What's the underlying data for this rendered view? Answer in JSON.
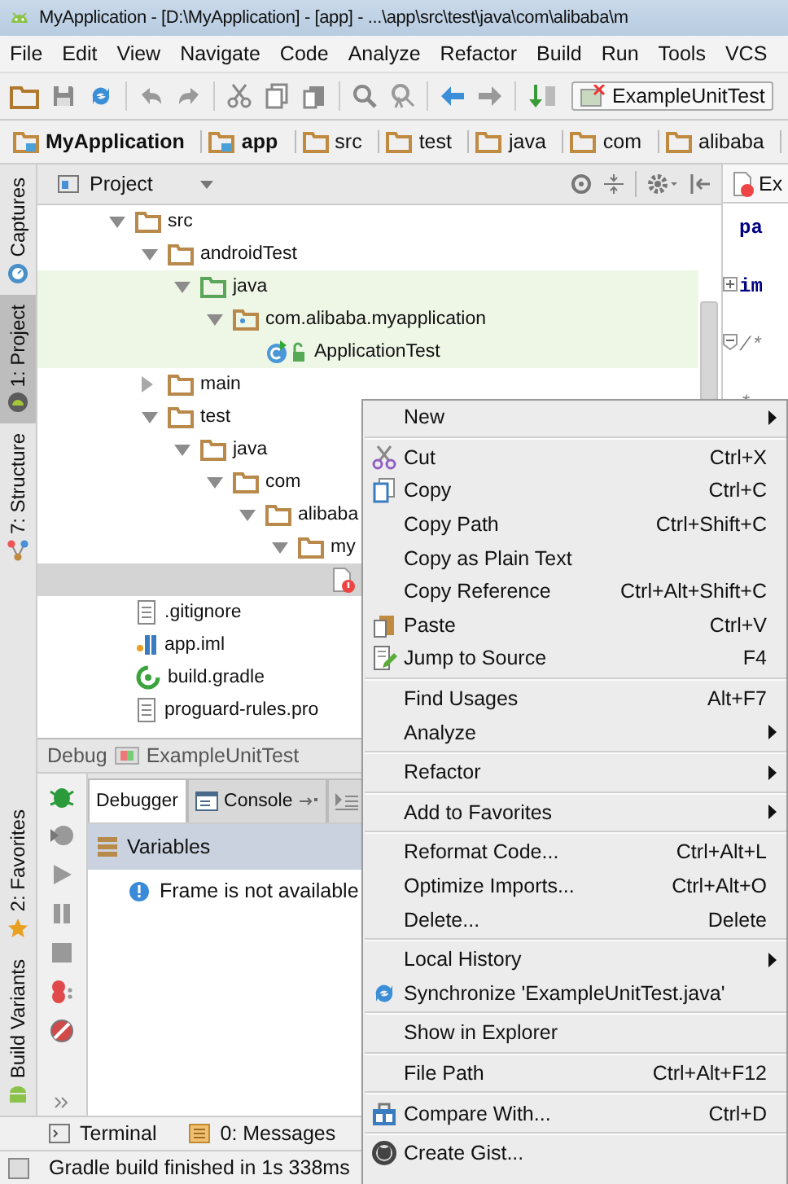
{
  "window": {
    "title": "MyApplication - [D:\\MyApplication] - [app] - ...\\app\\src\\test\\java\\com\\alibaba\\m"
  },
  "menu_bar": [
    "File",
    "Edit",
    "View",
    "Navigate",
    "Code",
    "Analyze",
    "Refactor",
    "Build",
    "Run",
    "Tools",
    "VCS"
  ],
  "toolbar": {
    "run_config": "ExampleUnitTest"
  },
  "breadcrumb": [
    {
      "label": "MyApplication",
      "kind": "module"
    },
    {
      "label": "app",
      "kind": "module"
    },
    {
      "label": "src",
      "kind": "folder"
    },
    {
      "label": "test",
      "kind": "folder"
    },
    {
      "label": "java",
      "kind": "folder"
    },
    {
      "label": "com",
      "kind": "folder"
    },
    {
      "label": "alibaba",
      "kind": "folder"
    }
  ],
  "left_tool_tabs": [
    {
      "label": "Captures",
      "selected": false
    },
    {
      "label": "1: Project",
      "selected": true
    },
    {
      "label": "7: Structure",
      "selected": false
    }
  ],
  "left_tool_tabs_bottom": [
    {
      "label": "2: Favorites",
      "selected": false
    },
    {
      "label": "Build Variants",
      "selected": false
    }
  ],
  "project_panel": {
    "view": "Project",
    "tree": [
      {
        "name": "src",
        "kind": "folder",
        "expanded": true,
        "selected": false,
        "highlighted": false,
        "children": [
          {
            "name": "androidTest",
            "kind": "folder",
            "expanded": true,
            "selected": false,
            "highlighted": false,
            "children": [
              {
                "name": "java",
                "kind": "source-folder",
                "expanded": true,
                "selected": false,
                "highlighted": true,
                "children": [
                  {
                    "name": "com.alibaba.myapplication",
                    "kind": "package",
                    "expanded": true,
                    "selected": false,
                    "highlighted": true,
                    "children": [
                      {
                        "name": "ApplicationTest",
                        "kind": "test-class",
                        "selected": false,
                        "highlighted": true
                      }
                    ]
                  }
                ]
              }
            ]
          },
          {
            "name": "main",
            "kind": "folder",
            "expanded": false,
            "selected": false,
            "highlighted": false
          },
          {
            "name": "test",
            "kind": "folder",
            "expanded": true,
            "selected": false,
            "highlighted": false,
            "children": [
              {
                "name": "java",
                "kind": "folder",
                "expanded": true,
                "selected": false,
                "highlighted": false,
                "children": [
                  {
                    "name": "com",
                    "kind": "folder",
                    "expanded": true,
                    "selected": false,
                    "highlighted": false,
                    "children": [
                      {
                        "name": "alibaba",
                        "kind": "folder",
                        "expanded": true,
                        "selected": false,
                        "highlighted": false,
                        "children": [
                          {
                            "name": "my",
                            "kind": "folder",
                            "expanded": true,
                            "selected": false,
                            "highlighted": false,
                            "children": [
                              {
                                "kind": "error-file",
                                "selected": true,
                                "highlighted": false
                              }
                            ]
                          }
                        ]
                      }
                    ]
                  }
                ]
              }
            ]
          }
        ]
      },
      {
        "name": ".gitignore",
        "kind": "text-file",
        "selected": false,
        "highlighted": false
      },
      {
        "name": "app.iml",
        "kind": "module-file",
        "selected": false,
        "highlighted": false
      },
      {
        "name": "build.gradle",
        "kind": "gradle-file",
        "selected": false,
        "highlighted": false
      },
      {
        "name": "proguard-rules.pro",
        "kind": "text-file",
        "selected": false,
        "highlighted": false
      }
    ]
  },
  "editor": {
    "tab": "Ex",
    "lines": [
      {
        "text": "pa",
        "kind": "keyword"
      },
      {
        "text": "im",
        "kind": "keyword-fold"
      },
      {
        "text": "/*",
        "kind": "comment-fold"
      },
      {
        "text": "*",
        "kind": "comment"
      }
    ]
  },
  "debug_panel": {
    "title": "Debug",
    "config": "ExampleUnitTest",
    "tabs": [
      {
        "label": "Debugger",
        "selected": true
      },
      {
        "label": "Console",
        "selected": false
      }
    ],
    "section": "Variables",
    "message": "Frame is not available"
  },
  "bottom_tabs": [
    "Terminal",
    "0: Messages"
  ],
  "status_bar": "Gradle build finished in 1s 338ms",
  "context_menu": [
    {
      "kind": "text",
      "label": "New",
      "submenu": true
    },
    {
      "kind": "separator"
    },
    {
      "kind": "cut",
      "label": "Cut",
      "shortcut": "Ctrl+X",
      "submenu": false
    },
    {
      "kind": "copy",
      "label": "Copy",
      "shortcut": "Ctrl+C",
      "submenu": false
    },
    {
      "kind": "text",
      "label": "Copy Path",
      "shortcut": "Ctrl+Shift+C",
      "submenu": false
    },
    {
      "kind": "text",
      "label": "Copy as Plain Text",
      "submenu": false
    },
    {
      "kind": "text",
      "label": "Copy Reference",
      "shortcut": "Ctrl+Alt+Shift+C",
      "submenu": false
    },
    {
      "kind": "paste",
      "label": "Paste",
      "shortcut": "Ctrl+V",
      "submenu": false
    },
    {
      "kind": "jump",
      "label": "Jump to Source",
      "shortcut": "F4",
      "submenu": false
    },
    {
      "kind": "separator"
    },
    {
      "kind": "text",
      "label": "Find Usages",
      "shortcut": "Alt+F7",
      "submenu": false
    },
    {
      "kind": "text",
      "label": "Analyze",
      "submenu": true
    },
    {
      "kind": "separator"
    },
    {
      "kind": "text",
      "label": "Refactor",
      "submenu": true
    },
    {
      "kind": "separator"
    },
    {
      "kind": "text",
      "label": "Add to Favorites",
      "submenu": true
    },
    {
      "kind": "separator"
    },
    {
      "kind": "text",
      "label": "Reformat Code...",
      "shortcut": "Ctrl+Alt+L",
      "submenu": false
    },
    {
      "kind": "text",
      "label": "Optimize Imports...",
      "shortcut": "Ctrl+Alt+O",
      "submenu": false
    },
    {
      "kind": "text",
      "label": "Delete...",
      "shortcut": "Delete",
      "submenu": false
    },
    {
      "kind": "separator"
    },
    {
      "kind": "text",
      "label": "Local History",
      "submenu": true
    },
    {
      "kind": "sync",
      "label": "Synchronize 'ExampleUnitTest.java'",
      "submenu": false
    },
    {
      "kind": "separator"
    },
    {
      "kind": "text",
      "label": "Show in Explorer",
      "submenu": false
    },
    {
      "kind": "separator"
    },
    {
      "kind": "text",
      "label": "File Path",
      "shortcut": "Ctrl+Alt+F12",
      "submenu": false
    },
    {
      "kind": "separator"
    },
    {
      "kind": "compare",
      "label": "Compare With...",
      "shortcut": "Ctrl+D",
      "submenu": false
    },
    {
      "kind": "separator"
    },
    {
      "kind": "gist",
      "label": "Create Gist...",
      "submenu": false
    }
  ]
}
